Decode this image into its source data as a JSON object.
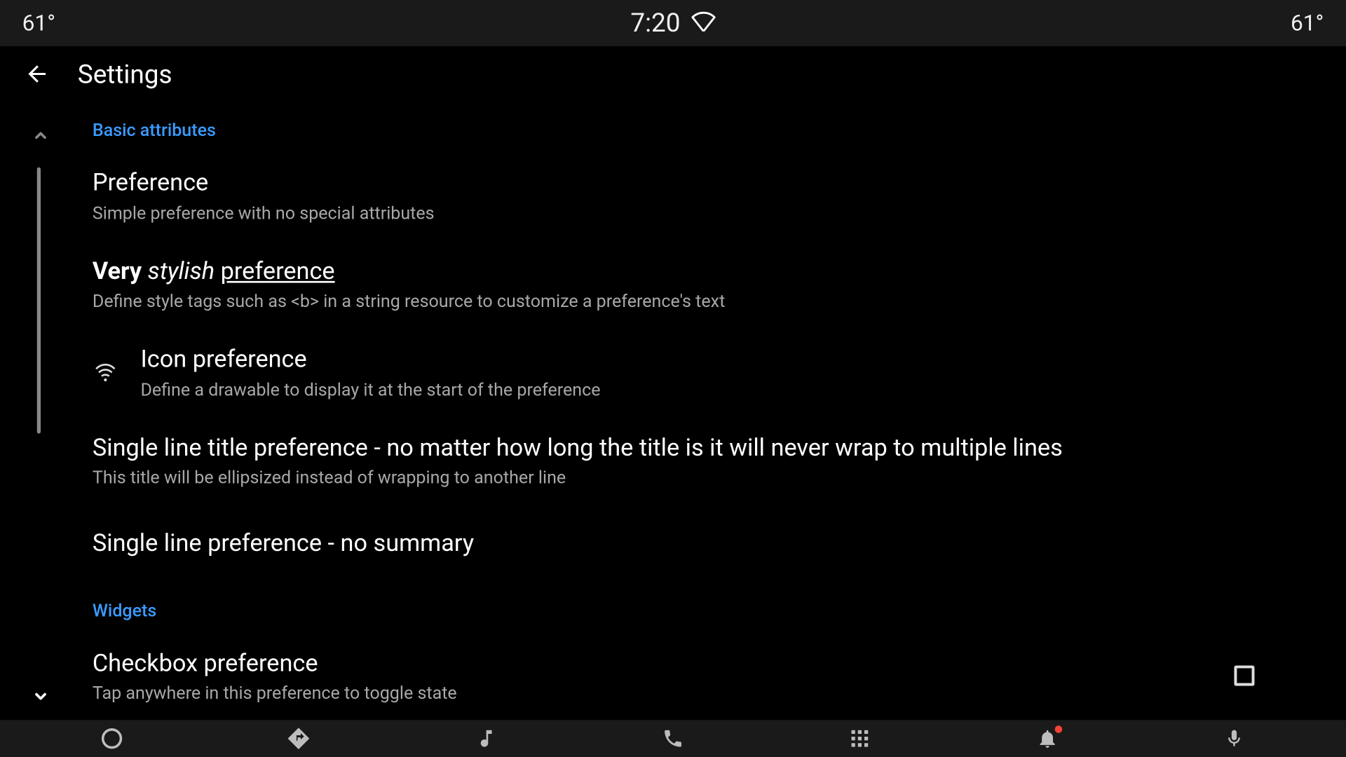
{
  "status": {
    "left_temp": "61°",
    "time": "7:20",
    "right_temp": "61°"
  },
  "appbar": {
    "title": "Settings"
  },
  "sections": {
    "basic_header": "Basic attributes",
    "widgets_header": "Widgets"
  },
  "prefs": {
    "simple": {
      "title": "Preference",
      "summary": "Simple preference with no special attributes"
    },
    "stylish": {
      "title_part1": "Very",
      "title_part2": "stylish",
      "title_part3": "preference",
      "summary": "Define style tags such as <b> in a string resource to customize a preference's text"
    },
    "icon": {
      "title": "Icon preference",
      "summary": "Define a drawable to display it at the start of the preference"
    },
    "singleline": {
      "title": "Single line title preference - no matter how long the title is it will never wrap to multiple lines",
      "summary": "This title will be ellipsized instead of wrapping to another line"
    },
    "nosummary": {
      "title": "Single line preference - no summary"
    },
    "checkbox": {
      "title": "Checkbox preference",
      "summary": "Tap anywhere in this preference to toggle state",
      "checked": false
    }
  }
}
